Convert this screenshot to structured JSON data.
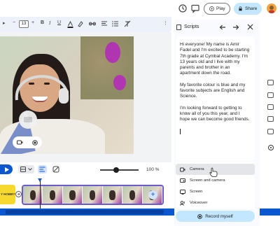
{
  "topbar": {
    "play_label": "Play",
    "share_label": "Share",
    "icons": [
      "history-icon",
      "comment-icon",
      "avatar"
    ]
  },
  "toolbar": {
    "font_size": "13",
    "minus": "−",
    "plus": "+",
    "bold": "B",
    "italic": "I",
    "underline": "U"
  },
  "slide_overlay": {
    "icons": [
      "camera-off-icon",
      "camera-icon",
      "record-icon"
    ]
  },
  "playbar": {
    "zoom_label": "100 %"
  },
  "timeline": {
    "hobby_label": "Y HOBBY",
    "add_label": "+"
  },
  "script": {
    "title": "Scripts",
    "paragraphs": [
      "Hi everyone! My name is Amir Fadel and I'm excited to be starting 7th grade at Cymbal Academy. I'm 13 years old and I live with my parents and brother in an apartment down the road.",
      "My favorite colour is blue and my favorite subjects are English and Science.",
      "I'm looking forward to getting to know all of you this year, and I hope we can become good friends."
    ]
  },
  "record_menu": {
    "items": [
      "Camera",
      "Screen and camera",
      "Screen",
      "Voiceover"
    ],
    "selected": "Camera"
  },
  "record_button": "Record myself",
  "colors": {
    "accent": "#0b57d0",
    "share_bg": "#c2e7ff",
    "hobby_yellow": "#f6d82f",
    "clip_border": "#6a5acd"
  }
}
